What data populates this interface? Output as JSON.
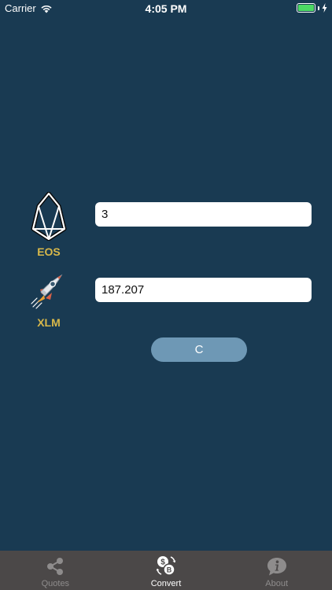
{
  "status_bar": {
    "carrier": "Carrier",
    "time": "4:05 PM",
    "battery_color": "#4CD964"
  },
  "converter": {
    "from": {
      "symbol": "EOS",
      "icon": "eos-logo-icon",
      "amount": "3"
    },
    "to": {
      "symbol": "XLM",
      "icon": "stellar-rocket-icon",
      "amount": "187.207"
    },
    "clear_label": "C"
  },
  "tabs": [
    {
      "label": "Quotes",
      "icon": "share-nodes-icon",
      "active": false
    },
    {
      "label": "Convert",
      "icon": "currency-exchange-icon",
      "active": true
    },
    {
      "label": "About",
      "icon": "info-bubble-icon",
      "active": false
    }
  ],
  "colors": {
    "background": "#193A52",
    "coin_label": "#D8B84A",
    "button": "#6E98B5",
    "tab_bar": "#4B4848"
  }
}
